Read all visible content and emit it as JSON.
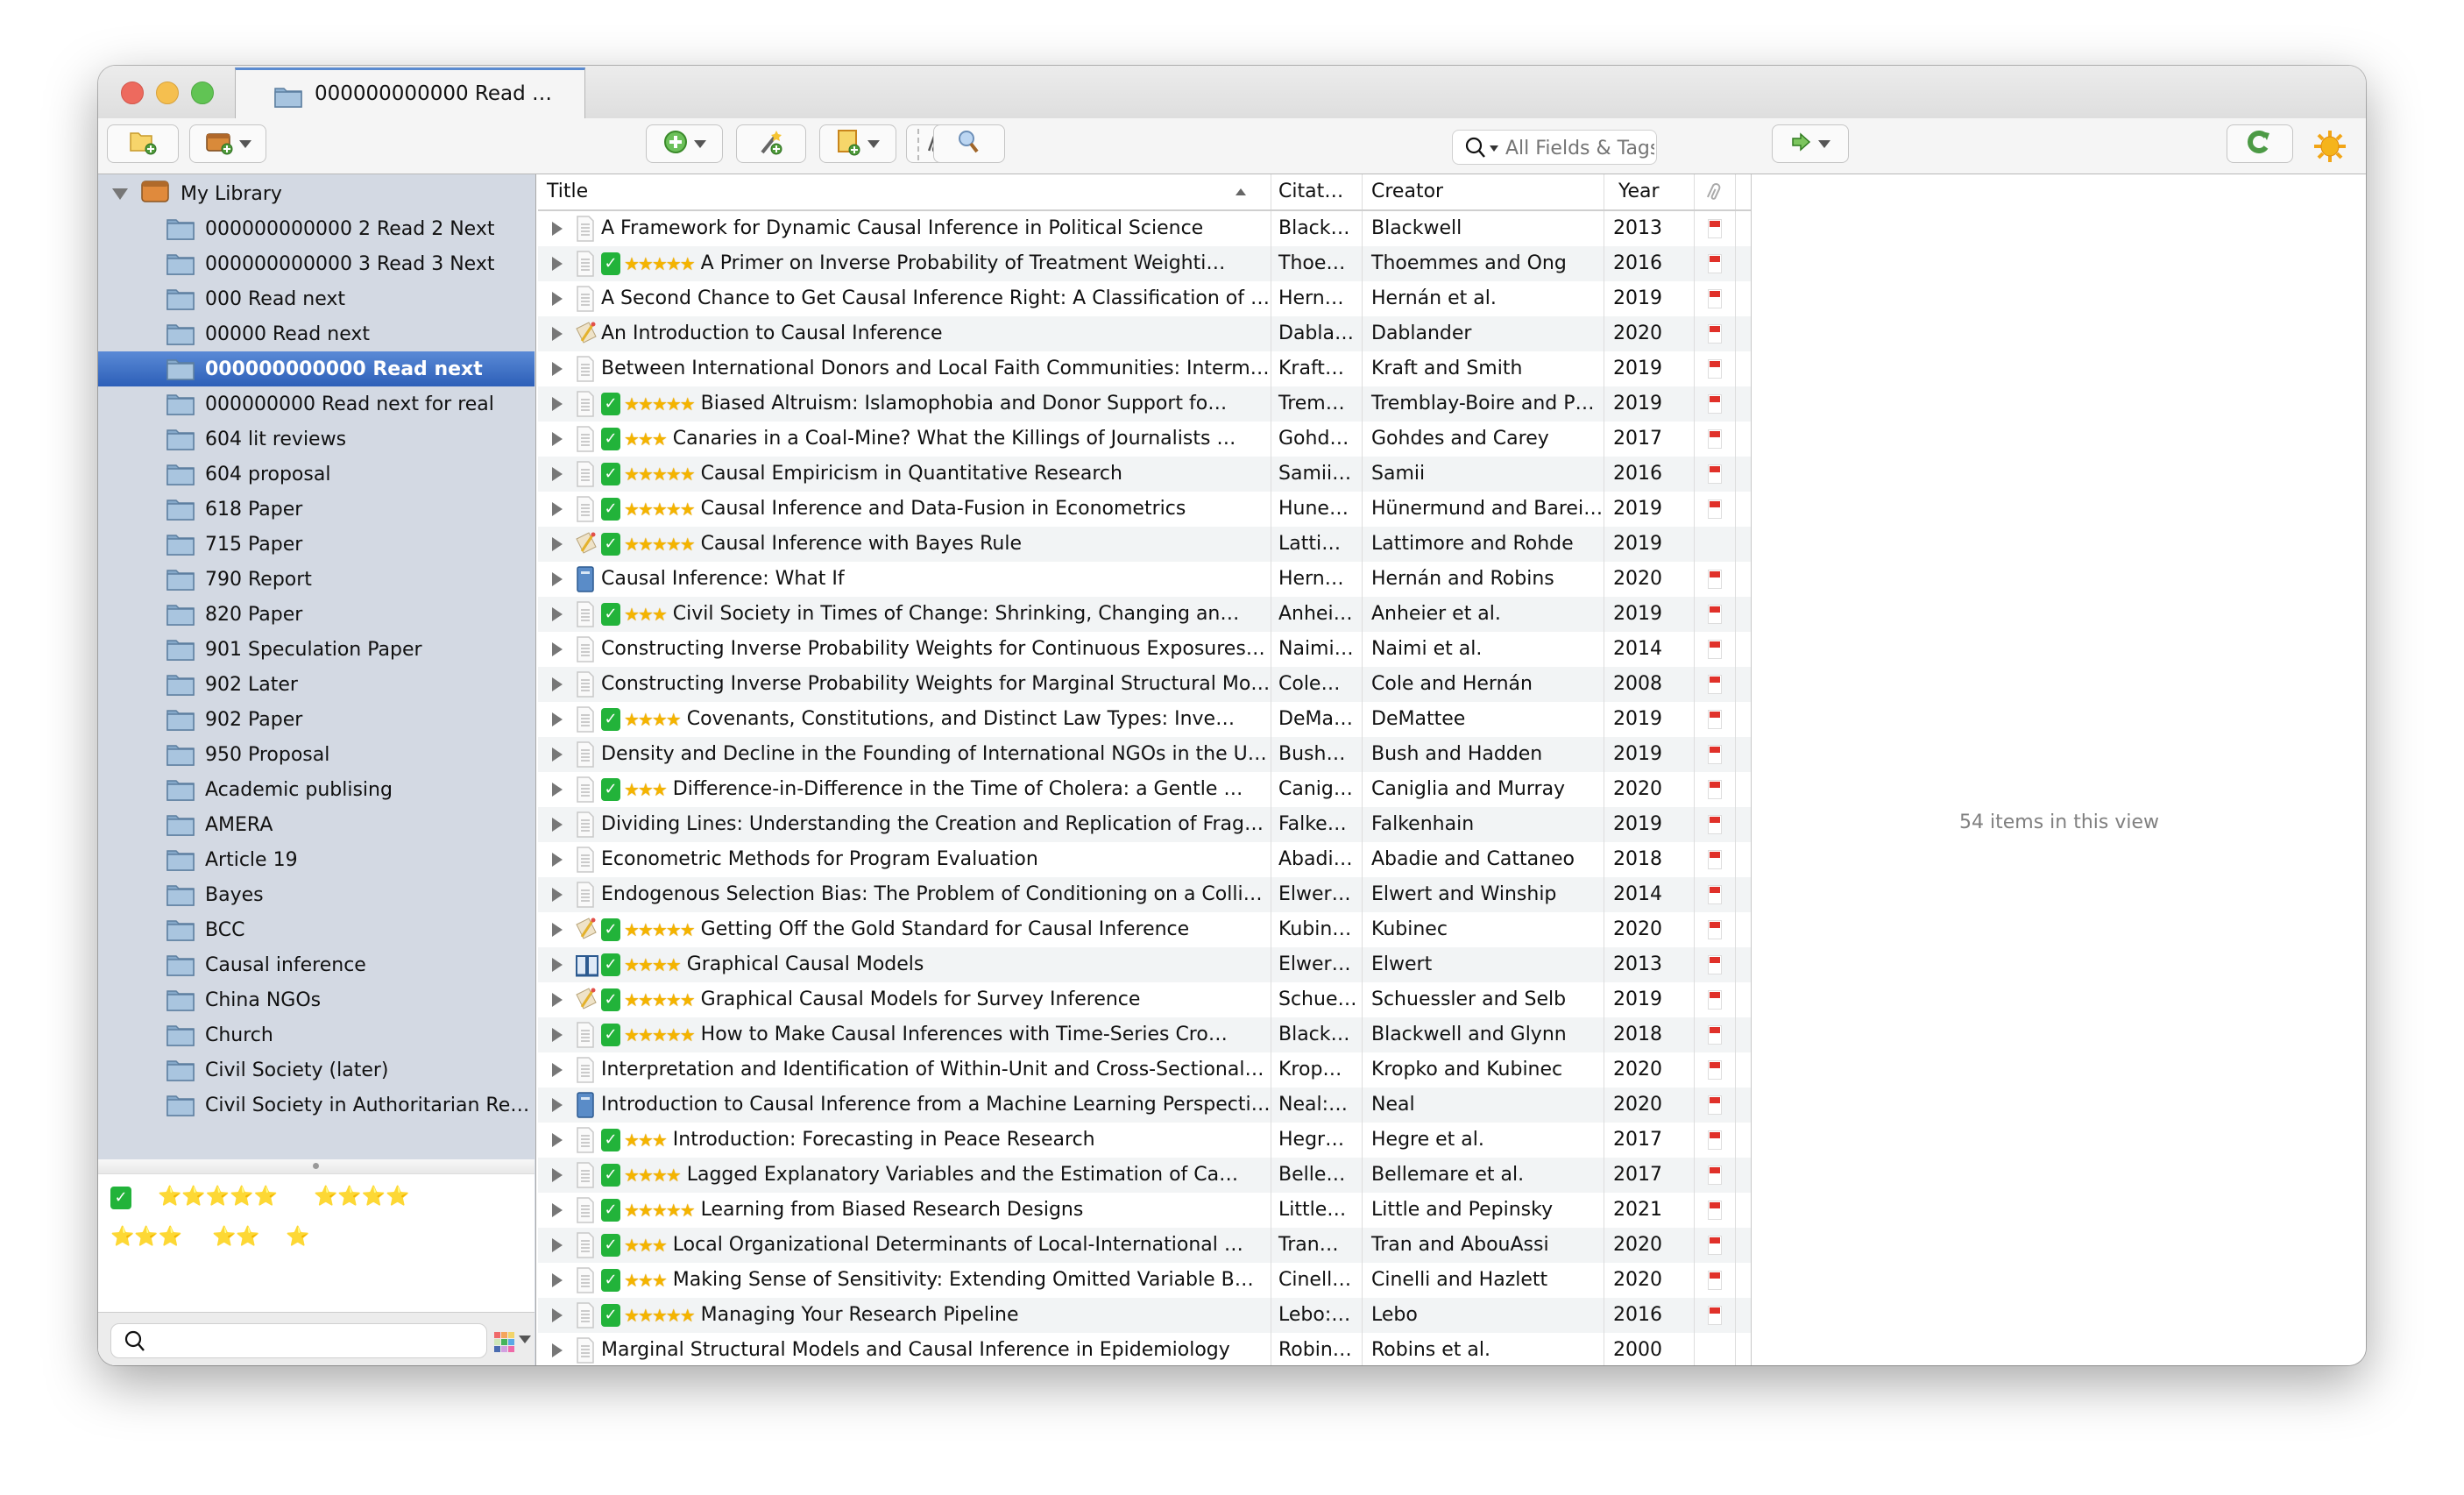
{
  "window": {
    "tab_title": "000000000000 Read …"
  },
  "toolbar": {
    "new_collection_icon": "folder-add-icon",
    "new_library_icon": "library-add-icon",
    "new_item_icon": "add-item-icon",
    "add_by_identifier_icon": "magic-wand-icon",
    "new_note_icon": "new-note-icon",
    "add_attachment_icon": "paperclip-icon",
    "advanced_search_icon": "magnifier-icon",
    "search_placeholder": "All Fields & Tags",
    "search_value": "",
    "locate_icon": "green-arrow-icon",
    "sync_icon": "sync-icon",
    "feedback_icon": "sun-icon"
  },
  "sidebar": {
    "library_label": "My Library",
    "collections": [
      "000000000000 2 Read 2 Next",
      "000000000000 3 Read 3 Next",
      "000 Read next",
      "00000 Read next",
      "000000000000 Read next",
      "000000000 Read next for real",
      "604 lit reviews",
      "604 proposal",
      "618 Paper",
      "715 Paper",
      "790 Report",
      "820 Paper",
      "901 Speculation Paper",
      "902 Later",
      "902 Paper",
      "950 Proposal",
      "Academic publising",
      "AMERA",
      "Article 19",
      "Bayes",
      "BCC",
      "Causal inference",
      "China NGOs",
      "Church",
      "Civil Society (later)",
      "Civil Society in Authoritarian Re…"
    ],
    "selected_index": 4,
    "tags": [
      "✅",
      "⭐⭐⭐⭐⭐",
      "⭐⭐⭐⭐",
      "⭐⭐⭐",
      "⭐⭐",
      "⭐"
    ],
    "tag_filter_value": ""
  },
  "items": {
    "columns": {
      "title": "Title",
      "citation": "Citat…",
      "creator": "Creator",
      "year": "Year"
    },
    "rows": [
      {
        "type": "document",
        "check": false,
        "stars": 0,
        "title": "A Framework for Dynamic Causal Inference in Political Science",
        "citation": "Black…",
        "creator": "Blackwell",
        "year": "2013",
        "pdf": true
      },
      {
        "type": "document",
        "check": true,
        "stars": 5,
        "title": "A Primer on Inverse Probability of Treatment Weighti…",
        "citation": "Thoe…",
        "creator": "Thoemmes and Ong",
        "year": "2016",
        "pdf": true
      },
      {
        "type": "document",
        "check": false,
        "stars": 0,
        "title": "A Second Chance to Get Causal Inference Right: A Classification of …",
        "citation": "Hern…",
        "creator": "Hernán et al.",
        "year": "2019",
        "pdf": true
      },
      {
        "type": "manuscript",
        "check": false,
        "stars": 0,
        "title": "An Introduction to Causal Inference",
        "citation": "Dabla…",
        "creator": "Dablander",
        "year": "2020",
        "pdf": true
      },
      {
        "type": "document",
        "check": false,
        "stars": 0,
        "title": "Between International Donors and Local Faith Communities: Interm…",
        "citation": "Kraft…",
        "creator": "Kraft and Smith",
        "year": "2019",
        "pdf": true
      },
      {
        "type": "document",
        "check": true,
        "stars": 5,
        "title": "Biased Altruism: Islamophobia and Donor Support fo…",
        "citation": "Trem…",
        "creator": "Tremblay-Boire and P…",
        "year": "2019",
        "pdf": true
      },
      {
        "type": "document",
        "check": true,
        "stars": 3,
        "title": "Canaries in a Coal-Mine? What the Killings of Journalists …",
        "citation": "Gohd…",
        "creator": "Gohdes and Carey",
        "year": "2017",
        "pdf": true
      },
      {
        "type": "document",
        "check": true,
        "stars": 5,
        "title": "Causal Empiricism in Quantitative Research",
        "citation": "Samii…",
        "creator": "Samii",
        "year": "2016",
        "pdf": true
      },
      {
        "type": "document",
        "check": true,
        "stars": 5,
        "title": "Causal Inference and Data-Fusion in Econometrics",
        "citation": "Hune…",
        "creator": "Hünermund and Barei…",
        "year": "2019",
        "pdf": true
      },
      {
        "type": "manuscript",
        "check": true,
        "stars": 5,
        "title": "Causal Inference with Bayes Rule",
        "citation": "Latti…",
        "creator": "Lattimore and Rohde",
        "year": "2019",
        "pdf": false
      },
      {
        "type": "book",
        "check": false,
        "stars": 0,
        "title": "Causal Inference: What If",
        "citation": "Hern…",
        "creator": "Hernán and Robins",
        "year": "2020",
        "pdf": true
      },
      {
        "type": "document",
        "check": true,
        "stars": 3,
        "title": "Civil Society in Times of Change: Shrinking, Changing an…",
        "citation": "Anhei…",
        "creator": "Anheier et al.",
        "year": "2019",
        "pdf": true
      },
      {
        "type": "document",
        "check": false,
        "stars": 0,
        "title": "Constructing Inverse Probability Weights for Continuous Exposures:…",
        "citation": "Naimi…",
        "creator": "Naimi et al.",
        "year": "2014",
        "pdf": true
      },
      {
        "type": "document",
        "check": false,
        "stars": 0,
        "title": "Constructing Inverse Probability Weights for Marginal Structural Mo…",
        "citation": "Cole…",
        "creator": "Cole and Hernán",
        "year": "2008",
        "pdf": true
      },
      {
        "type": "document",
        "check": true,
        "stars": 4,
        "title": "Covenants, Constitutions, and Distinct Law Types: Inve…",
        "citation": "DeMa…",
        "creator": "DeMattee",
        "year": "2019",
        "pdf": true
      },
      {
        "type": "document",
        "check": false,
        "stars": 0,
        "title": "Density and Decline in the Founding of International NGOs in the U…",
        "citation": "Bush…",
        "creator": "Bush and Hadden",
        "year": "2019",
        "pdf": true
      },
      {
        "type": "document",
        "check": true,
        "stars": 3,
        "title": "Difference-in-Difference in the Time of Cholera: a Gentle …",
        "citation": "Canig…",
        "creator": "Caniglia and Murray",
        "year": "2020",
        "pdf": true
      },
      {
        "type": "document",
        "check": false,
        "stars": 0,
        "title": "Dividing Lines: Understanding the Creation and Replication of Frag…",
        "citation": "Falke…",
        "creator": "Falkenhain",
        "year": "2019",
        "pdf": true
      },
      {
        "type": "document",
        "check": false,
        "stars": 0,
        "title": "Econometric Methods for Program Evaluation",
        "citation": "Abadi…",
        "creator": "Abadie and Cattaneo",
        "year": "2018",
        "pdf": true
      },
      {
        "type": "document",
        "check": false,
        "stars": 0,
        "title": "Endogenous Selection Bias: The Problem of Conditioning on a Colli…",
        "citation": "Elwer…",
        "creator": "Elwert and Winship",
        "year": "2014",
        "pdf": true
      },
      {
        "type": "manuscript",
        "check": true,
        "stars": 5,
        "title": "Getting Off the Gold Standard for Causal Inference",
        "citation": "Kubin…",
        "creator": "Kubinec",
        "year": "2020",
        "pdf": true
      },
      {
        "type": "book-section",
        "check": true,
        "stars": 4,
        "title": "Graphical Causal Models",
        "citation": "Elwer…",
        "creator": "Elwert",
        "year": "2013",
        "pdf": true
      },
      {
        "type": "manuscript",
        "check": true,
        "stars": 5,
        "title": "Graphical Causal Models for Survey Inference",
        "citation": "Schue…",
        "creator": "Schuessler and Selb",
        "year": "2019",
        "pdf": true
      },
      {
        "type": "document",
        "check": true,
        "stars": 5,
        "title": "How to Make Causal Inferences with Time-Series Cro…",
        "citation": "Black…",
        "creator": "Blackwell and Glynn",
        "year": "2018",
        "pdf": true
      },
      {
        "type": "document",
        "check": false,
        "stars": 0,
        "title": "Interpretation and Identification of Within-Unit and Cross-Sectional…",
        "citation": "Krop…",
        "creator": "Kropko and Kubinec",
        "year": "2020",
        "pdf": true
      },
      {
        "type": "book",
        "check": false,
        "stars": 0,
        "title": "Introduction to Causal Inference from a Machine Learning Perspective",
        "citation": "Neal:…",
        "creator": "Neal",
        "year": "2020",
        "pdf": true
      },
      {
        "type": "document",
        "check": true,
        "stars": 3,
        "title": "Introduction: Forecasting in Peace Research",
        "citation": "Hegr…",
        "creator": "Hegre et al.",
        "year": "2017",
        "pdf": true
      },
      {
        "type": "document",
        "check": true,
        "stars": 4,
        "title": "Lagged Explanatory Variables and the Estimation of Ca…",
        "citation": "Belle…",
        "creator": "Bellemare et al.",
        "year": "2017",
        "pdf": true
      },
      {
        "type": "document",
        "check": true,
        "stars": 5,
        "title": "Learning from Biased Research Designs",
        "citation": "Little…",
        "creator": "Little and Pepinsky",
        "year": "2021",
        "pdf": true
      },
      {
        "type": "document",
        "check": true,
        "stars": 3,
        "title": "Local Organizational Determinants of Local-International …",
        "citation": "Tran…",
        "creator": "Tran and AbouAssi",
        "year": "2020",
        "pdf": true
      },
      {
        "type": "document",
        "check": true,
        "stars": 3,
        "title": "Making Sense of Sensitivity: Extending Omitted Variable B…",
        "citation": "Cinell…",
        "creator": "Cinelli and Hazlett",
        "year": "2020",
        "pdf": true
      },
      {
        "type": "document",
        "check": true,
        "stars": 5,
        "title": "Managing Your Research Pipeline",
        "citation": "Lebo:…",
        "creator": "Lebo",
        "year": "2016",
        "pdf": true
      },
      {
        "type": "document",
        "check": false,
        "stars": 0,
        "title": "Marginal Structural Models and Causal Inference in Epidemiology",
        "citation": "Robin…",
        "creator": "Robins et al.",
        "year": "2000",
        "pdf": false
      }
    ]
  },
  "item_pane": {
    "count_text": "54 items in this view"
  }
}
